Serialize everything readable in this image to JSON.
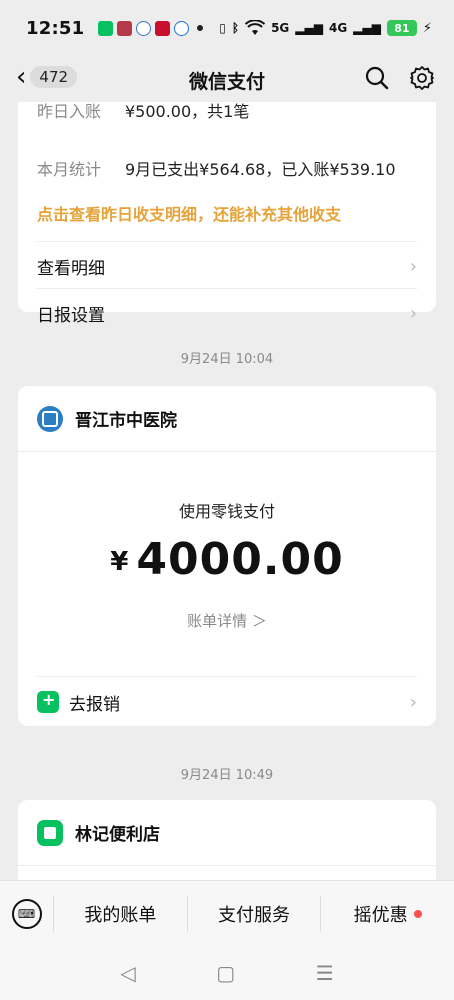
{
  "status_bar": {
    "time": "12:51",
    "signal_5g": "5G",
    "signal_4g": "4G",
    "battery": "81"
  },
  "nav": {
    "back_count": "472",
    "title": "微信支付"
  },
  "daily_card": {
    "row1_key": "昨日入账",
    "row1_value": "¥500.00，共1笔",
    "row2_key": "本月统计",
    "row2_value": "9月已支出¥564.68，已入账¥539.10",
    "link": "点击查看昨日收支明细，还能补充其他收支",
    "menu1": "查看明细",
    "menu2": "日报设置"
  },
  "timestamps": {
    "first": "9月24日 10:04",
    "second": "9月24日 10:49"
  },
  "payment_card": {
    "merchant": "晋江市中医院",
    "method": "使用零钱支付",
    "currency": "¥",
    "amount": "4000.00",
    "detail_link": "账单详情 ＞",
    "reimburse": "去报销"
  },
  "second_card": {
    "merchant": "林记便利店"
  },
  "bottom_bar": {
    "tab1": "我的账单",
    "tab2": "支付服务",
    "tab3": "摇优惠"
  }
}
